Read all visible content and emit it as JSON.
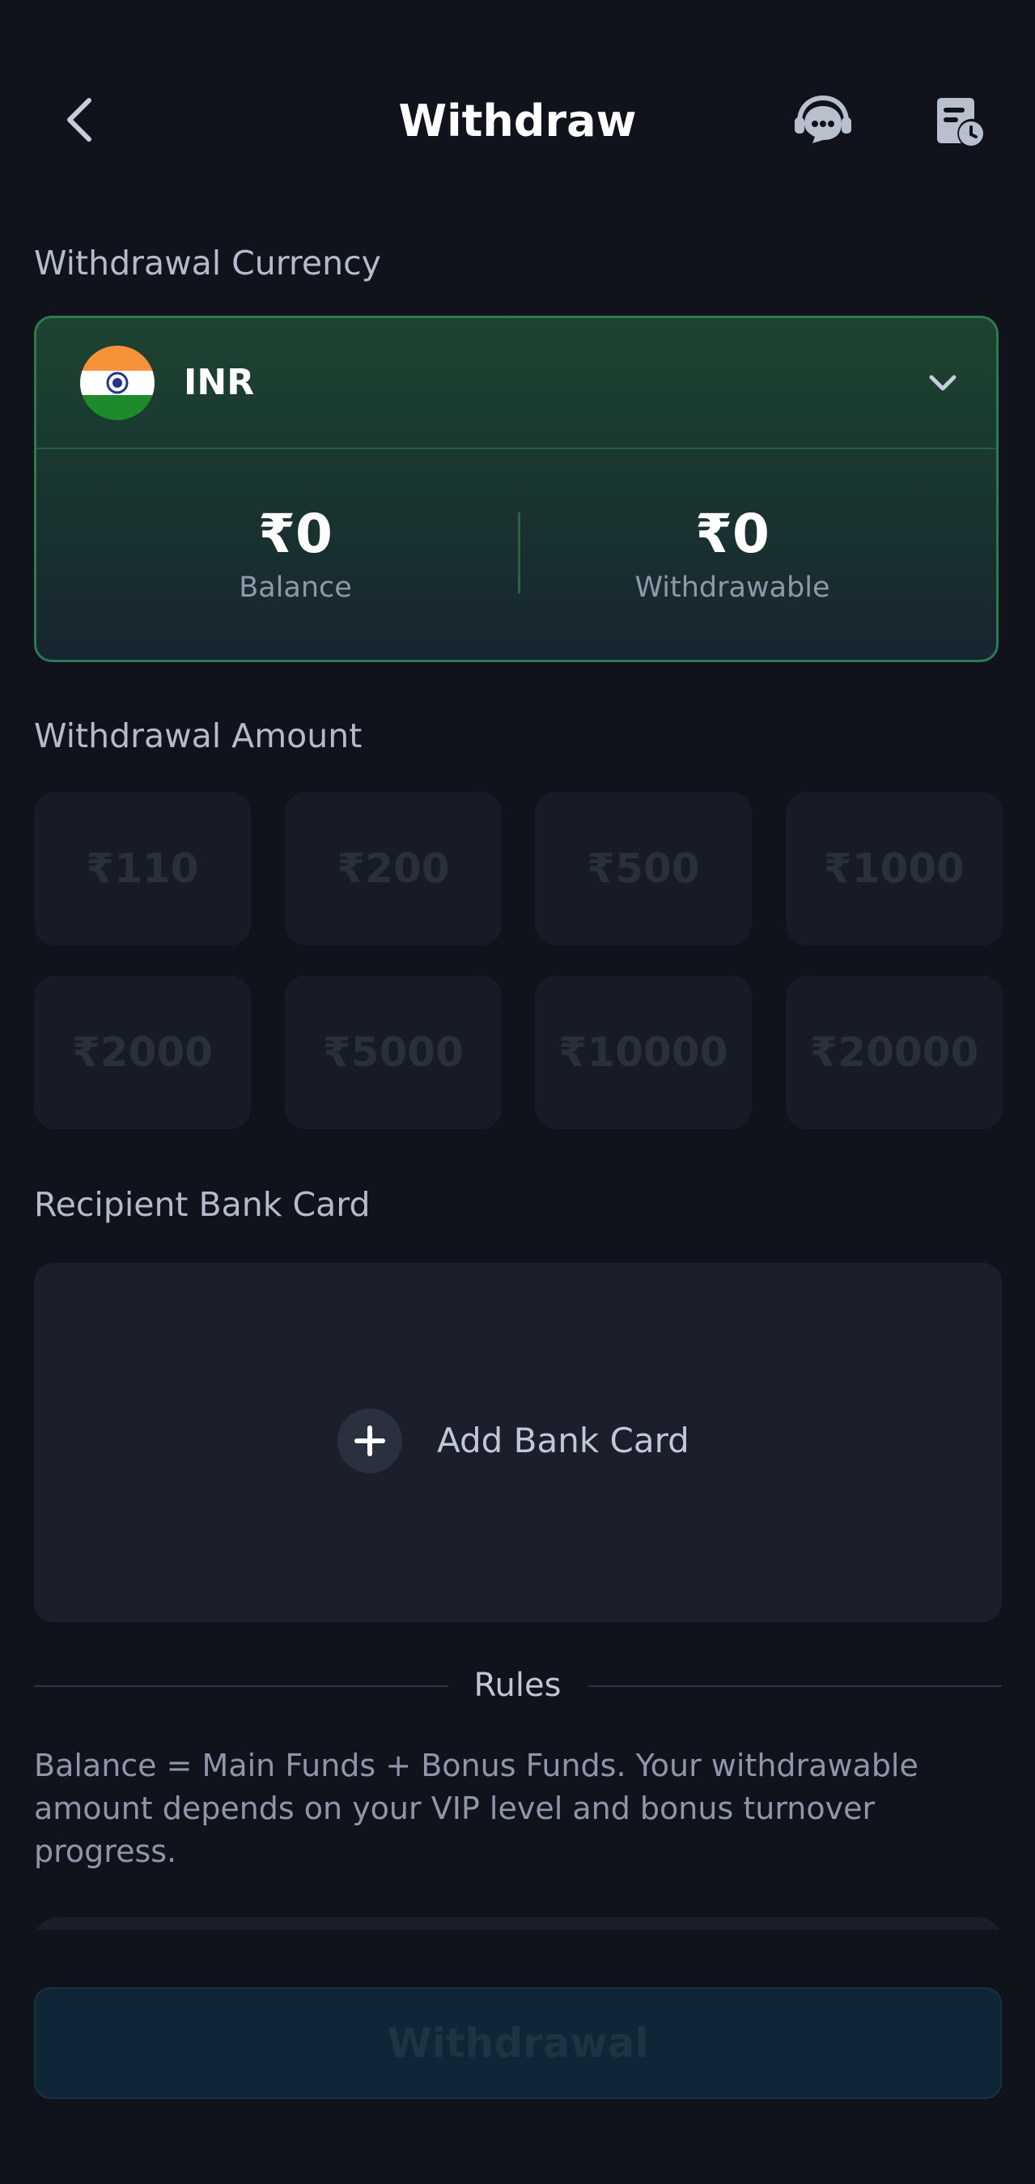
{
  "header": {
    "title": "Withdraw",
    "back_icon": "chevron-left-icon",
    "support_icon": "headset-chat-icon",
    "records_icon": "document-clock-icon"
  },
  "currency_section": {
    "label": "Withdrawal Currency",
    "selected_currency": "INR",
    "flag_icon": "india-flag-icon",
    "dropdown_icon": "chevron-down-icon",
    "balance_value": "₹0",
    "balance_label": "Balance",
    "withdrawable_value": "₹0",
    "withdrawable_label": "Withdrawable"
  },
  "amount_section": {
    "label": "Withdrawal Amount",
    "options": [
      "₹110",
      "₹200",
      "₹500",
      "₹1000",
      "₹2000",
      "₹5000",
      "₹10000",
      "₹20000"
    ]
  },
  "bank_section": {
    "label": "Recipient Bank Card",
    "add_label": "Add Bank Card",
    "add_icon": "plus-icon"
  },
  "rules": {
    "title": "Rules",
    "text": "Balance = Main Funds + Bonus Funds. Your withdrawable amount depends on your VIP level and bonus turnover progress."
  },
  "submit": {
    "label": "Withdrawal"
  },
  "colors": {
    "background": "#10131b",
    "card_border": "#2c7a4e",
    "card_top": "#1d4331",
    "tile": "#171b25",
    "button": "#0f2636"
  }
}
